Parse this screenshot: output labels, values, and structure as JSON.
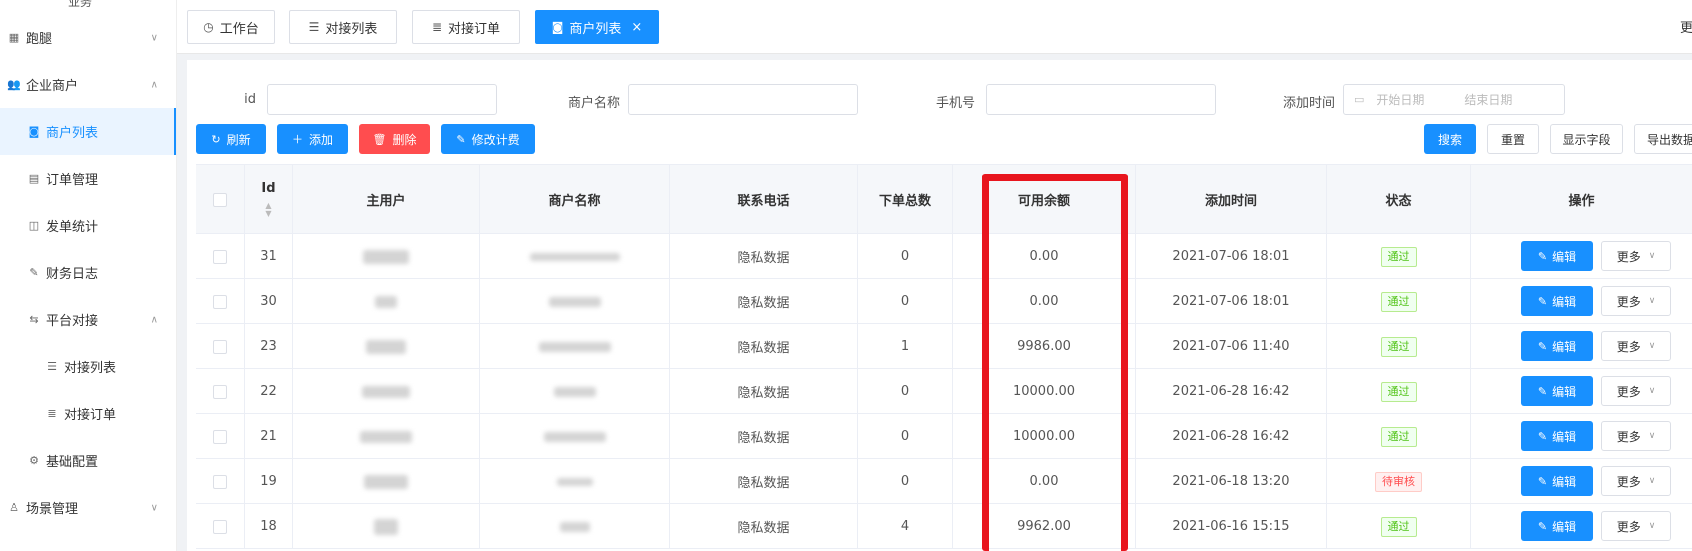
{
  "sidebar": {
    "top_partial": "业务",
    "items": [
      {
        "label": "跑腿",
        "icon": "grid-icon",
        "chevron": "∨"
      },
      {
        "label": "企业商户",
        "icon": "users-icon",
        "chevron": "∧"
      },
      {
        "label": "商户列表",
        "icon": "user-card-icon",
        "active": true
      },
      {
        "label": "订单管理",
        "icon": "document-icon"
      },
      {
        "label": "发单统计",
        "icon": "chart-icon"
      },
      {
        "label": "财务日志",
        "icon": "edit-document-icon"
      },
      {
        "label": "平台对接",
        "icon": "swap-icon",
        "chevron": "∧"
      },
      {
        "label": "对接列表",
        "icon": "list-icon"
      },
      {
        "label": "对接订单",
        "icon": "order-icon"
      },
      {
        "label": "基础配置",
        "icon": "gear-icon"
      },
      {
        "label": "场景管理",
        "icon": "person-icon",
        "chevron": "∨"
      }
    ]
  },
  "tabs": [
    {
      "label": "工作台",
      "icon": "dashboard-icon"
    },
    {
      "label": "对接列表",
      "icon": "list-icon"
    },
    {
      "label": "对接订单",
      "icon": "order-icon"
    },
    {
      "label": "商户列表",
      "icon": "user-card-icon",
      "active": true,
      "close": "×"
    }
  ],
  "header_edge_text": "更",
  "filters": {
    "id_label": "id",
    "name_label": "商户名称",
    "phone_label": "手机号",
    "time_label": "添加时间",
    "id_value": "",
    "name_value": "",
    "phone_value": "",
    "start_placeholder": "开始日期",
    "end_placeholder": "结束日期"
  },
  "toolbar": {
    "refresh": "刷新",
    "add": "添加",
    "delete": "删除",
    "edit_fee": "修改计费",
    "search": "搜索",
    "reset": "重置",
    "show_fields": "显示字段",
    "export": "导出数据"
  },
  "table": {
    "headers": {
      "id": "Id",
      "main_user": "主用户",
      "merchant_name": "商户名称",
      "phone": "联系电话",
      "total_orders": "下单总数",
      "balance": "可用余额",
      "add_time": "添加时间",
      "status": "状态",
      "actions": "操作"
    },
    "edit_label": "编辑",
    "more_label": "更多",
    "rows": [
      {
        "id": "31",
        "phone": "隐私数据",
        "orders": "0",
        "balance": "0.00",
        "time": "2021-07-06 18:01",
        "status": "通过",
        "status_type": "ok"
      },
      {
        "id": "30",
        "phone": "隐私数据",
        "orders": "0",
        "balance": "0.00",
        "time": "2021-07-06 18:01",
        "status": "通过",
        "status_type": "ok"
      },
      {
        "id": "23",
        "phone": "隐私数据",
        "orders": "1",
        "balance": "9986.00",
        "time": "2021-07-06 11:40",
        "status": "通过",
        "status_type": "ok"
      },
      {
        "id": "22",
        "phone": "隐私数据",
        "orders": "0",
        "balance": "10000.00",
        "time": "2021-06-28 16:42",
        "status": "通过",
        "status_type": "ok"
      },
      {
        "id": "21",
        "phone": "隐私数据",
        "orders": "0",
        "balance": "10000.00",
        "time": "2021-06-28 16:42",
        "status": "通过",
        "status_type": "ok"
      },
      {
        "id": "19",
        "phone": "隐私数据",
        "orders": "0",
        "balance": "0.00",
        "time": "2021-06-18 13:20",
        "status": "待审核",
        "status_type": "pending"
      },
      {
        "id": "18",
        "phone": "隐私数据",
        "orders": "4",
        "balance": "9962.00",
        "time": "2021-06-16 15:15",
        "status": "通过",
        "status_type": "ok"
      }
    ]
  },
  "colors": {
    "primary": "#1890ff",
    "danger": "#ff4d4f",
    "highlight": "#e8151e"
  }
}
